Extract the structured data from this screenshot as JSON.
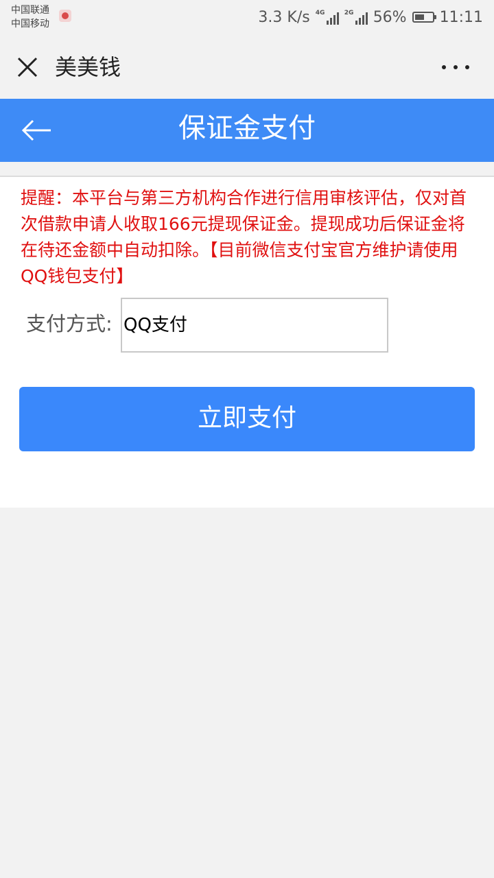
{
  "status_bar": {
    "carrier_1": "中国联通",
    "carrier_2": "中国移动",
    "net_speed": "3.3 K/s",
    "signal_1_tag": "4G",
    "signal_2_tag": "2G",
    "battery": "56%",
    "battery_level": 0.56,
    "time": "11:11"
  },
  "wechat_bar": {
    "title": "美美钱",
    "close_icon": "close-icon",
    "more_icon": "more-icon"
  },
  "header": {
    "title": "保证金支付",
    "back_icon": "back-arrow-icon",
    "color": "#3e8bf6"
  },
  "notice": {
    "text": "提醒：本平台与第三方机构合作进行信用审核评估，仅对首次借款申请人收取166元提现保证金。提现成功后保证金将在待还金额中自动扣除。【目前微信支付宝官方维护请使用QQ钱包支付】",
    "color": "#e01010"
  },
  "payment": {
    "label": "支付方式:",
    "selected": "QQ支付"
  },
  "pay_button": {
    "label": "立即支付",
    "color": "#3a88fb"
  }
}
